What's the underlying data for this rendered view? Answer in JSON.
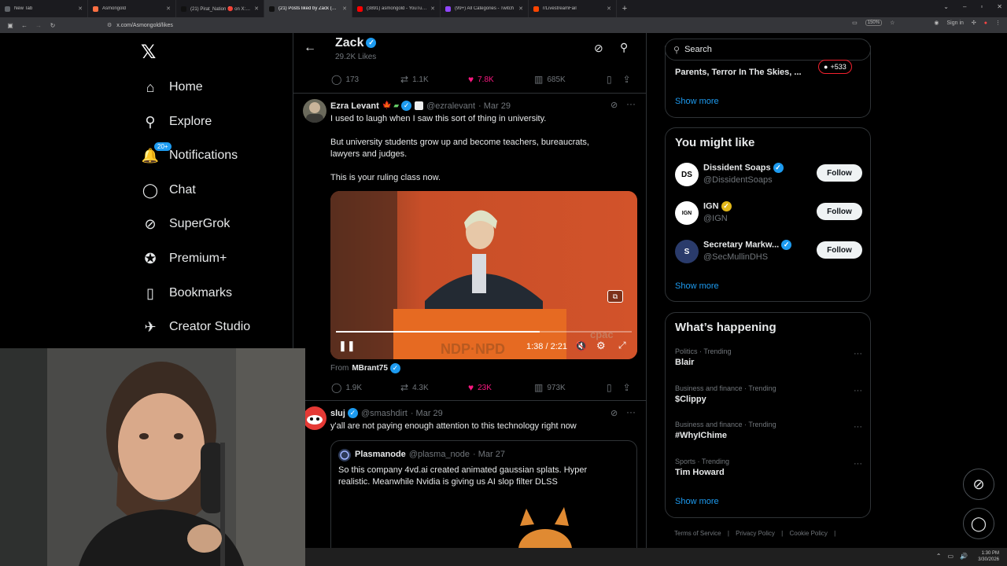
{
  "browser": {
    "tabs": [
      {
        "title": "New Tab",
        "color": "#5f6368"
      },
      {
        "title": "Asmongold",
        "color": "#ff7043"
      },
      {
        "title": "(21) Pirat_Nation 🔴 on X: \"Wo...",
        "color": "#111111"
      },
      {
        "title": "(21) Posts liked by Zack (@Asm...",
        "color": "#111111",
        "active": true
      },
      {
        "title": "(3891) asmongold - YouTube",
        "color": "#ff0000"
      },
      {
        "title": "(99+) All Categories - Twitch",
        "color": "#9146ff"
      },
      {
        "title": "r/LivestreamFail",
        "color": "#ff4500"
      }
    ],
    "url": "x.com/Asmongold/likes",
    "zoom": "150%",
    "sign_in": "Sign in"
  },
  "nav": {
    "items": [
      {
        "label": "Home",
        "icon": "home-icon",
        "glyph": "⌂"
      },
      {
        "label": "Explore",
        "icon": "search-icon",
        "glyph": "⚲"
      },
      {
        "label": "Notifications",
        "icon": "bell-icon",
        "glyph": "🔔"
      },
      {
        "label": "Chat",
        "icon": "chat-icon",
        "glyph": "◯"
      },
      {
        "label": "SuperGrok",
        "icon": "grok-icon",
        "glyph": "⊘"
      },
      {
        "label": "Premium+",
        "icon": "verified-icon",
        "glyph": "✪"
      },
      {
        "label": "Bookmarks",
        "icon": "bookmark-icon",
        "glyph": "▯"
      },
      {
        "label": "Creator Studio",
        "icon": "rocket-icon",
        "glyph": "✈"
      }
    ],
    "notification_badge": "20+"
  },
  "header": {
    "name": "Zack",
    "likes_count": "29.2K Likes"
  },
  "top_actions": {
    "replies": "173",
    "reposts": "1.1K",
    "likes": "7.8K",
    "views": "685K"
  },
  "tweet1": {
    "name": "Ezra Levant",
    "handle": "@ezralevant",
    "date": "· Mar 29",
    "lines": [
      "I used to laugh when I saw this sort of thing in university.",
      "But university students grow up and become teachers, bureaucrats,",
      "lawyers and judges.",
      "This is your ruling class now."
    ],
    "video_time": "1:38 / 2:21",
    "video_progress": 0.69,
    "from_label": "From",
    "from_name": "MBrant75",
    "actions": {
      "replies": "1.9K",
      "reposts": "4.3K",
      "likes": "23K",
      "views": "973K"
    }
  },
  "tweet2": {
    "name": "sluj",
    "handle": "@smashdirt",
    "date": "· Mar 29",
    "text": "y'all are not paying enough attention to this technology right now",
    "quote": {
      "name": "Plasmanode",
      "handle": "@plasma_node",
      "date": "· Mar 27",
      "text_line1": "So this company 4vd.ai created animated gaussian splats. Hyper",
      "text_line2": "realistic. Meanwhile Nvidia is giving us AI slop filter DLSS"
    }
  },
  "right": {
    "search_placeholder": "Search",
    "top_card_text": "Parents, Terror In The Skies, ...",
    "top_card_badge": "+533",
    "show_more": "Show more",
    "you_might_like": "You might like",
    "suggestions": [
      {
        "name": "Dissident Soaps",
        "handle": "@DissidentSoaps",
        "follow": "Follow",
        "initials": "DS"
      },
      {
        "name": "IGN",
        "handle": "@IGN",
        "follow": "Follow",
        "initials": "IGN"
      },
      {
        "name": "Secretary Markw...",
        "handle": "@SecMullinDHS",
        "follow": "Follow",
        "initials": "S"
      }
    ],
    "whats_happening": "What’s happening",
    "trends": [
      {
        "context": "Politics · Trending",
        "name": "Blair"
      },
      {
        "context": "Business and finance · Trending",
        "name": "$Clippy"
      },
      {
        "context": "Business and finance · Trending",
        "name": "#WhyIChime"
      },
      {
        "context": "Sports · Trending",
        "name": "Tim Howard"
      }
    ],
    "footer": [
      "Terms of Service",
      "Privacy Policy",
      "Cookie Policy"
    ]
  },
  "taskbar": {
    "time": "1:30 PM",
    "date": "3/30/2026"
  }
}
